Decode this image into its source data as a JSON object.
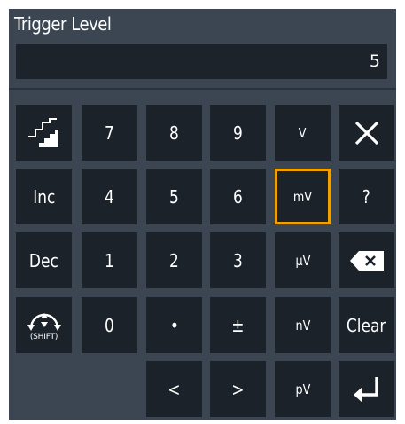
{
  "dialog": {
    "title": "Trigger Level",
    "value": "5"
  },
  "keys": {
    "step_icon": "step-increment-icon",
    "seven": "7",
    "eight": "8",
    "nine": "9",
    "volt": "V",
    "close_icon": "close-icon",
    "inc": "Inc",
    "four": "4",
    "five": "5",
    "six": "6",
    "millivolt": "mV",
    "help": "?",
    "dec": "Dec",
    "one": "1",
    "two": "2",
    "three": "3",
    "microvolt": "µV",
    "backspace_icon": "backspace-icon",
    "shift_label": "(SHIFT)",
    "zero": "0",
    "decimal": "•",
    "plus_minus": "±",
    "nanovolt": "nV",
    "clear": "Clear",
    "left": "<",
    "right": ">",
    "picovolt": "pV",
    "enter_icon": "enter-icon"
  },
  "selected_unit": "mV",
  "colors": {
    "panel_bg": "#3b4652",
    "key_bg": "#1b222a",
    "selected_border": "#f0a000",
    "text": "#ffffff"
  }
}
